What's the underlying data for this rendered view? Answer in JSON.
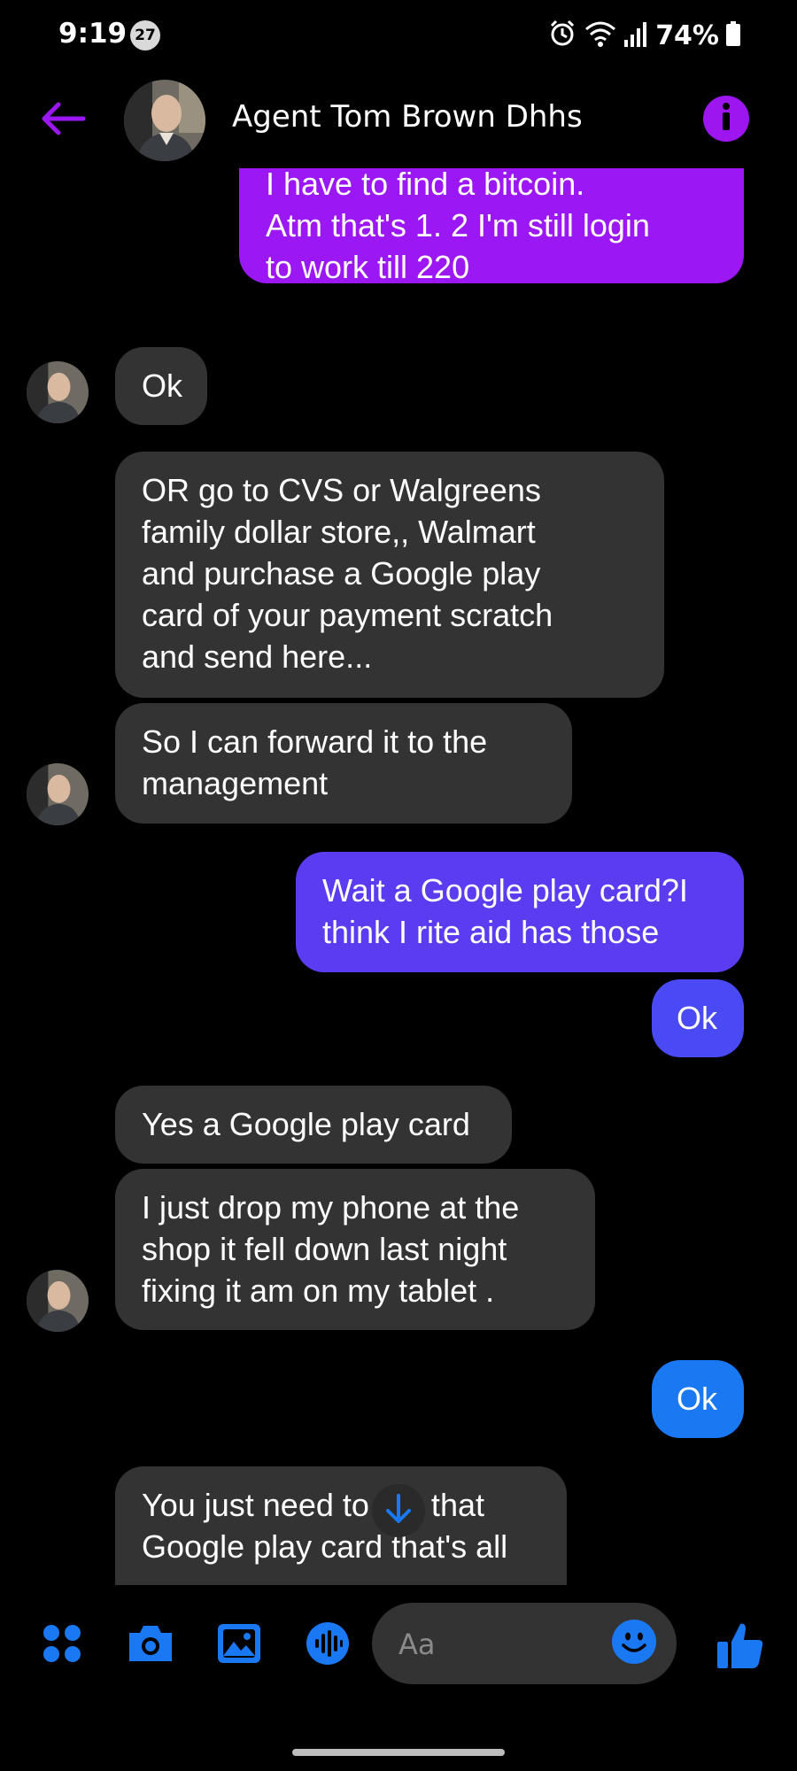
{
  "status_bar": {
    "time": "9:19",
    "notification_count": "27",
    "battery": "74%",
    "icons": [
      "alarm-icon",
      "wifi-icon",
      "signal-icon",
      "battery-icon"
    ]
  },
  "header": {
    "contact_name": "Agent Tom Brown Dhhs",
    "back_icon": "back-arrow-icon",
    "info_icon": "info-icon"
  },
  "colors": {
    "accent_purple": "#9b17f3",
    "incoming_bubble": "#333333",
    "outgoing_violet": "#5b3cf0",
    "outgoing_blue": "#1a78f2",
    "icon_blue": "#1a78f2"
  },
  "messages": [
    {
      "direction": "outgoing",
      "text": "I have to find a bitcoin.\nAtm that's 1. 2 I'm still login\nto work till 220"
    },
    {
      "direction": "incoming",
      "text": "Ok"
    },
    {
      "direction": "incoming",
      "text": "OR go to CVS or Walgreens\nfamily dollar store,, Walmart\nand purchase a Google play\ncard of your payment scratch\nand send here..."
    },
    {
      "direction": "incoming",
      "text": "So I can forward it to the\nmanagement"
    },
    {
      "direction": "outgoing",
      "text": "Wait a Google play card?I\nthink I rite aid has those"
    },
    {
      "direction": "outgoing",
      "text": "Ok"
    },
    {
      "direction": "incoming",
      "text": "Yes a Google play card"
    },
    {
      "direction": "incoming",
      "text": "I just drop my phone at the\nshop it fell down last night\nfixing it am on my tablet ."
    },
    {
      "direction": "outgoing",
      "text": "Ok"
    },
    {
      "direction": "incoming",
      "text": "You just need to get that\nGoogle play card that's all"
    }
  ],
  "composer": {
    "placeholder": "Aa",
    "icons": [
      "apps-icon",
      "camera-icon",
      "gallery-icon",
      "voice-icon",
      "emoji-icon",
      "thumbs-up-icon"
    ]
  }
}
